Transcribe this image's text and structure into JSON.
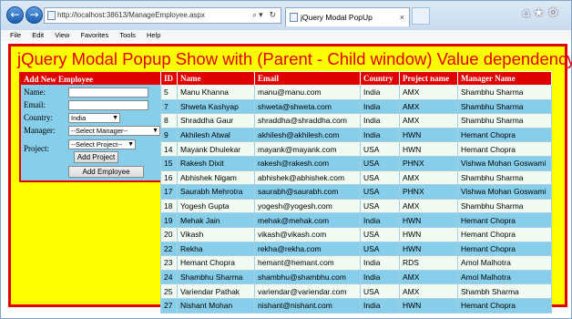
{
  "browser": {
    "url": "http://localhost:38613/ManageEmployee.aspx",
    "tab_title": "jQuery Modal PopUp",
    "menu": [
      "File",
      "Edit",
      "View",
      "Favorites",
      "Tools",
      "Help"
    ]
  },
  "page": {
    "title": "jQuery Modal Popup Show with (Parent - Child window) Value dependency"
  },
  "form": {
    "header": "Add New Employee",
    "name_label": "Name:",
    "email_label": "Email:",
    "country_label": "Country:",
    "manager_label": "Manager:",
    "project_label": "Project:",
    "country_value": "India",
    "manager_value": "--Select Manager--",
    "project_value": "--Select Project--",
    "add_project_button": "Add Project",
    "add_employee_button": "Add Employee"
  },
  "table": {
    "columns": [
      "ID",
      "Name",
      "Email",
      "Country",
      "Project name",
      "Manager Name"
    ],
    "rows": [
      [
        "5",
        "Manu Khanna",
        "manu@manu.com",
        "India",
        "AMX",
        "Shambhu Sharma"
      ],
      [
        "7",
        "Shweta Kashyap",
        "shweta@shweta.com",
        "India",
        "AMX",
        "Shambhu Sharma"
      ],
      [
        "8",
        "Shraddha Gaur",
        "shraddha@shraddha.com",
        "India",
        "AMX",
        "Shambhu Sharma"
      ],
      [
        "9",
        "Akhilesh Atwal",
        "akhilesh@akhilesh.com",
        "India",
        "HWN",
        "Hemant Chopra"
      ],
      [
        "14",
        "Mayank Dhulekar",
        "mayank@mayank.com",
        "USA",
        "HWN",
        "Hemant Chopra"
      ],
      [
        "15",
        "Rakesh Dixit",
        "rakesh@rakesh.com",
        "USA",
        "PHNX",
        "Vishwa Mohan Goswami"
      ],
      [
        "16",
        "Abhishek Nigam",
        "abhishek@abhishek.com",
        "USA",
        "AMX",
        "Shambhu Sharma"
      ],
      [
        "17",
        "Saurabh Mehrotra",
        "saurabh@saurabh.com",
        "USA",
        "PHNX",
        "Vishwa Mohan Goswami"
      ],
      [
        "18",
        "Yogesh Gupta",
        "yogesh@yogesh.com",
        "USA",
        "AMX",
        "Shambhu Sharma"
      ],
      [
        "19",
        "Mehak Jain",
        "mehak@mehak.com",
        "India",
        "HWN",
        "Hemant Chopra"
      ],
      [
        "20",
        "Vikash",
        "vikash@vikash.com",
        "USA",
        "HWN",
        "Hemant Chopra"
      ],
      [
        "22",
        "Rekha",
        "rekha@rekha.com",
        "USA",
        "HWN",
        "Hemant Chopra"
      ],
      [
        "23",
        "Hemant Chopra",
        "hemant@hemant.com",
        "India",
        "RDS",
        "Amol Malhotra"
      ],
      [
        "24",
        "Shambhu Sharma",
        "shambhu@shambhu.com",
        "India",
        "AMX",
        "Amol Malhotra"
      ],
      [
        "25",
        "Variendar Pathak",
        "variendar@variendar.com",
        "USA",
        "AMX",
        "Shambh Sharma"
      ],
      [
        "27",
        "Nishant Mohan",
        "nishant@nishant.com",
        "India",
        "HWN",
        "Hemant Chopra"
      ]
    ]
  },
  "colors": {
    "page_background": "#ffff00",
    "accent_red": "#e00000",
    "row_blue": "#87ceeb",
    "row_light": "#f2fbf2"
  }
}
